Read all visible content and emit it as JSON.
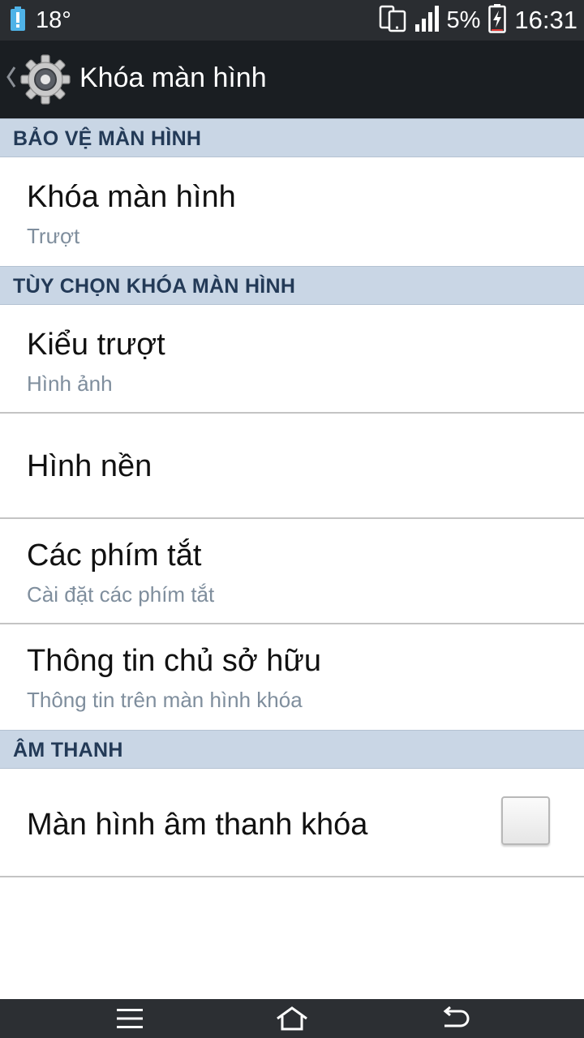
{
  "status_bar": {
    "temperature": "18°",
    "battery_percent": "5%",
    "time": "16:31",
    "icons": [
      "battery-alert-icon",
      "dual-screen-icon",
      "signal-icon",
      "battery-charging-icon"
    ]
  },
  "action_bar": {
    "title": "Khóa màn hình",
    "icons": [
      "back-chevron-icon",
      "settings-gear-icon"
    ]
  },
  "sections": [
    {
      "header": "BẢO VỆ MÀN HÌNH",
      "items": [
        {
          "title": "Khóa màn hình",
          "subtitle": "Trượt"
        }
      ]
    },
    {
      "header": "TÙY CHỌN KHÓA MÀN HÌNH",
      "items": [
        {
          "title": "Kiểu trượt",
          "subtitle": "Hình ảnh"
        },
        {
          "title": "Hình nền"
        },
        {
          "title": "Các phím tắt",
          "subtitle": "Cài đặt các phím tắt"
        },
        {
          "title": "Thông tin chủ sở hữu",
          "subtitle": "Thông tin trên màn hình khóa"
        }
      ]
    },
    {
      "header": "ÂM THANH",
      "items": [
        {
          "title": "Màn hình âm thanh khóa",
          "checked": false
        }
      ]
    }
  ],
  "nav_bar": {
    "icons": [
      "menu-icon",
      "home-icon",
      "back-icon"
    ]
  },
  "colors": {
    "status_bar_bg": "#2a2d31",
    "action_bar_bg": "#1a1e22",
    "section_header_bg": "#c9d6e5",
    "section_header_text": "#233a57",
    "subtitle_text": "#7f8e9d",
    "nav_bar_bg": "#2c2f33"
  }
}
